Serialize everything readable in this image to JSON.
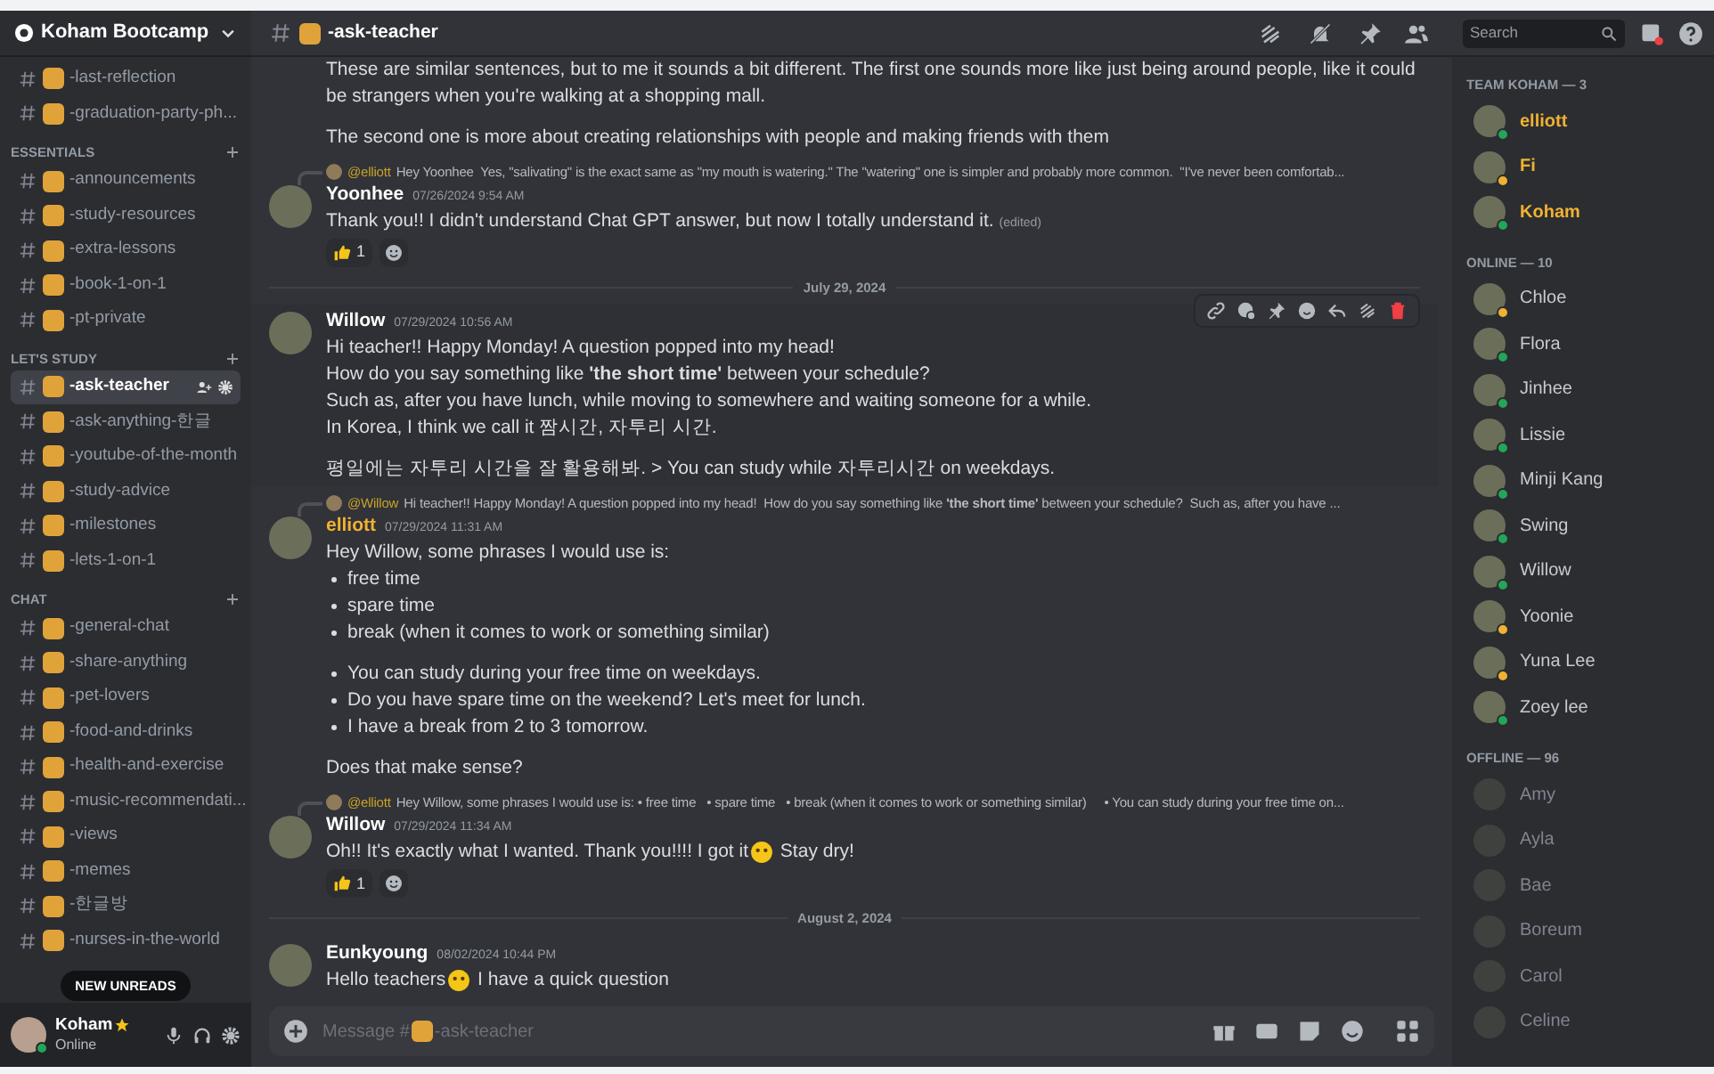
{
  "server": {
    "name": "Koham Bootcamp"
  },
  "channel_groups": [
    {
      "channels": [
        {
          "name": "-last-reflection",
          "selected": false
        },
        {
          "name": "-graduation-party-ph...",
          "selected": false
        }
      ]
    },
    {
      "title": "ESSENTIALS",
      "channels": [
        {
          "name": "-announcements",
          "selected": false
        },
        {
          "name": "-study-resources",
          "selected": false
        },
        {
          "name": "-extra-lessons",
          "selected": false
        },
        {
          "name": "-book-1-on-1",
          "selected": false
        },
        {
          "name": "-pt-private",
          "selected": false
        }
      ]
    },
    {
      "title": "LET'S STUDY",
      "channels": [
        {
          "name": "-ask-teacher",
          "selected": true
        },
        {
          "name": "-ask-anything-한글",
          "selected": false
        },
        {
          "name": "-youtube-of-the-month",
          "selected": false
        },
        {
          "name": "-study-advice",
          "selected": false
        },
        {
          "name": "-milestones",
          "selected": false
        },
        {
          "name": "-lets-1-on-1",
          "selected": false
        }
      ]
    },
    {
      "title": "CHAT",
      "channels": [
        {
          "name": "-general-chat",
          "selected": false
        },
        {
          "name": "-share-anything",
          "selected": false
        },
        {
          "name": "-pet-lovers",
          "selected": false
        },
        {
          "name": "-food-and-drinks",
          "selected": false
        },
        {
          "name": "-health-and-exercise",
          "selected": false
        },
        {
          "name": "-music-recommendati...",
          "selected": false
        },
        {
          "name": "-views",
          "selected": false
        },
        {
          "name": "-memes",
          "selected": false
        },
        {
          "name": "-한글방",
          "selected": false
        },
        {
          "name": "-nurses-in-the-world",
          "selected": false
        }
      ]
    }
  ],
  "unreads_pill": "NEW UNREADS",
  "user_panel": {
    "name": "Koham",
    "status": "Online"
  },
  "header": {
    "channel": "-ask-teacher"
  },
  "messages": [
    {
      "kind": "continuation",
      "body": [
        {
          "kind": "line",
          "text": "These are similar sentences, but to me it sounds a bit different. The first one sounds more like just being around people, like it could be strangers when you're walking at a shopping mall."
        },
        {
          "kind": "gap"
        },
        {
          "kind": "line",
          "text": "The second one is more about creating relationships with people and making friends with them"
        }
      ]
    },
    {
      "kind": "message",
      "reply": {
        "author": "@elliott",
        "text": "Hey Yoonhee  Yes, \"salivating\" is the exact same as \"my mouth is watering.\" The \"watering\" one is simpler and probably more common.  \"I've never been comfortab..."
      },
      "author": "Yoonhee",
      "team": false,
      "time": "07/26/2024 9:54 AM",
      "body": [
        {
          "kind": "line",
          "text": "Thank you!! I didn't understand Chat GPT answer, but now I totally understand it.",
          "edited": "(edited)"
        }
      ],
      "reactions": [
        {
          "count": "1"
        }
      ]
    },
    {
      "kind": "divider",
      "text": "July 29, 2024"
    },
    {
      "kind": "message",
      "author": "Willow",
      "team": false,
      "time": "07/29/2024 10:56 AM",
      "hovered": true,
      "body": [
        {
          "kind": "line",
          "text": "Hi teacher!! Happy Monday! A question popped into my head!"
        },
        {
          "kind": "line",
          "text": "How do you say something like **'the short time'** between your schedule?"
        },
        {
          "kind": "line",
          "text": "Such as, after you have lunch, while moving to somewhere and waiting someone for a while."
        },
        {
          "kind": "line",
          "text": "In Korea, I think we call it 짬시간, 자투리 시간."
        },
        {
          "kind": "gap"
        },
        {
          "kind": "line",
          "text": "평일에는 자투리 시간을 잘 활용해봐. > You can study while 자투리시간 on weekdays."
        }
      ]
    },
    {
      "kind": "message",
      "reply": {
        "author": "@Willow",
        "text": "Hi teacher!! Happy Monday! A question popped into my head!  How do you say something like **'the short time'** between your schedule?  Such as, after you have ..."
      },
      "author": "elliott",
      "team": true,
      "time": "07/29/2024 11:31 AM",
      "body": [
        {
          "kind": "line",
          "text": "Hey Willow, some phrases I would use is:"
        },
        {
          "kind": "bullet",
          "text": "free time"
        },
        {
          "kind": "bullet",
          "text": "spare time"
        },
        {
          "kind": "bullet",
          "text": "break (when it comes to work or something similar)"
        },
        {
          "kind": "gap"
        },
        {
          "kind": "bullet",
          "text": "You can study during your free time on weekdays."
        },
        {
          "kind": "bullet",
          "text": "Do you have spare time on the weekend? Let's meet for lunch."
        },
        {
          "kind": "bullet",
          "text": "I have a break from 2 to 3 tomorrow."
        },
        {
          "kind": "gap"
        },
        {
          "kind": "line",
          "text": "Does that make sense?"
        }
      ]
    },
    {
      "kind": "message",
      "reply": {
        "author": "@elliott",
        "text": "Hey Willow, some phrases I would use is: • free time   • spare time   • break (when it comes to work or something similar)     • You can study during your free time on..."
      },
      "author": "Willow",
      "team": false,
      "time": "07/29/2024 11:34 AM",
      "body": [
        {
          "kind": "emoji_line",
          "before": "Oh!! It's exactly what I wanted. Thank you!!!! I got it",
          "after": " Stay dry!"
        }
      ],
      "reactions": [
        {
          "count": "1"
        }
      ]
    },
    {
      "kind": "divider",
      "text": "August 2, 2024"
    },
    {
      "kind": "message",
      "author": "Eunkyoung",
      "team": false,
      "time": "08/02/2024 10:44 PM",
      "body": [
        {
          "kind": "emoji_line",
          "before": "Hello teachers",
          "after": " I have a quick question"
        }
      ]
    }
  ],
  "composer": {
    "prefix": "Message #",
    "channel": "-ask-teacher"
  },
  "search": {
    "placeholder": "Search"
  },
  "member_groups": [
    {
      "title": "TEAM KOHAM — 3",
      "kind": "team",
      "members": [
        {
          "name": "elliott",
          "idle": false
        },
        {
          "name": "Fi",
          "idle": true
        },
        {
          "name": "Koham",
          "idle": false
        }
      ]
    },
    {
      "title": "ONLINE — 10",
      "kind": "online",
      "members": [
        {
          "name": "Chloe",
          "idle": true
        },
        {
          "name": "Flora",
          "idle": false
        },
        {
          "name": "Jinhee",
          "idle": false
        },
        {
          "name": "Lissie",
          "idle": false
        },
        {
          "name": "Minji Kang",
          "idle": false
        },
        {
          "name": "Swing",
          "idle": false
        },
        {
          "name": "Willow",
          "idle": false
        },
        {
          "name": "Yoonie",
          "idle": true
        },
        {
          "name": "Yuna Lee",
          "idle": true
        },
        {
          "name": "Zoey lee",
          "idle": false
        }
      ]
    },
    {
      "title": "OFFLINE — 96",
      "kind": "offline",
      "members": [
        {
          "name": "Amy"
        },
        {
          "name": "Ayla"
        },
        {
          "name": "Bae"
        },
        {
          "name": "Boreum"
        },
        {
          "name": "Carol"
        },
        {
          "name": "Celine"
        }
      ]
    }
  ]
}
